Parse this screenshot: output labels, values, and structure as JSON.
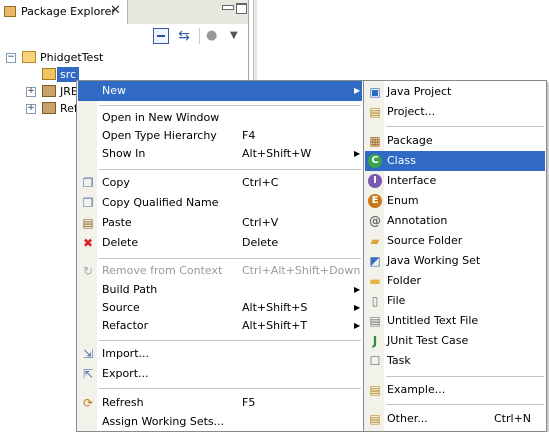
{
  "view": {
    "tab_title": "Package Explorer",
    "tab_close": "✕",
    "toolbar": {
      "collapse_icon": "collapse-all-icon",
      "link_icon": "link-with-editor-icon",
      "filter_icon": "filter-icon",
      "menu_icon": "view-menu-icon"
    }
  },
  "tree": {
    "project": "PhidgetTest",
    "src": "src",
    "jre": "JRE",
    "ref": "Ref",
    "expanded_symbol": "−",
    "collapsed_symbol": "+"
  },
  "context_menu": {
    "new": "New",
    "open_new_window": "Open in New Window",
    "open_type_hierarchy": "Open Type Hierarchy",
    "open_type_hierarchy_shortcut": "F4",
    "show_in": "Show In",
    "show_in_shortcut": "Alt+Shift+W",
    "copy": "Copy",
    "copy_shortcut": "Ctrl+C",
    "copy_qualified": "Copy Qualified Name",
    "paste": "Paste",
    "paste_shortcut": "Ctrl+V",
    "delete": "Delete",
    "delete_shortcut": "Delete",
    "remove_context": "Remove from Context",
    "remove_context_shortcut": "Ctrl+Alt+Shift+Down",
    "build_path": "Build Path",
    "source": "Source",
    "source_shortcut": "Alt+Shift+S",
    "refactor": "Refactor",
    "refactor_shortcut": "Alt+Shift+T",
    "import": "Import...",
    "export": "Export...",
    "refresh": "Refresh",
    "refresh_shortcut": "F5",
    "assign_working_sets": "Assign Working Sets..."
  },
  "new_submenu": {
    "java_project": "Java Project",
    "project": "Project...",
    "package": "Package",
    "class": "Class",
    "interface": "Interface",
    "enum": "Enum",
    "annotation": "Annotation",
    "source_folder": "Source Folder",
    "java_working_set": "Java Working Set",
    "folder": "Folder",
    "file": "File",
    "untitled_text_file": "Untitled Text File",
    "junit_test_case": "JUnit Test Case",
    "task": "Task",
    "example": "Example...",
    "other": "Other...",
    "other_shortcut": "Ctrl+N"
  },
  "colors": {
    "selection": "#316ac5",
    "menu_gutter": "#f2f1ea",
    "tab_bar": "#e8e7e0"
  }
}
